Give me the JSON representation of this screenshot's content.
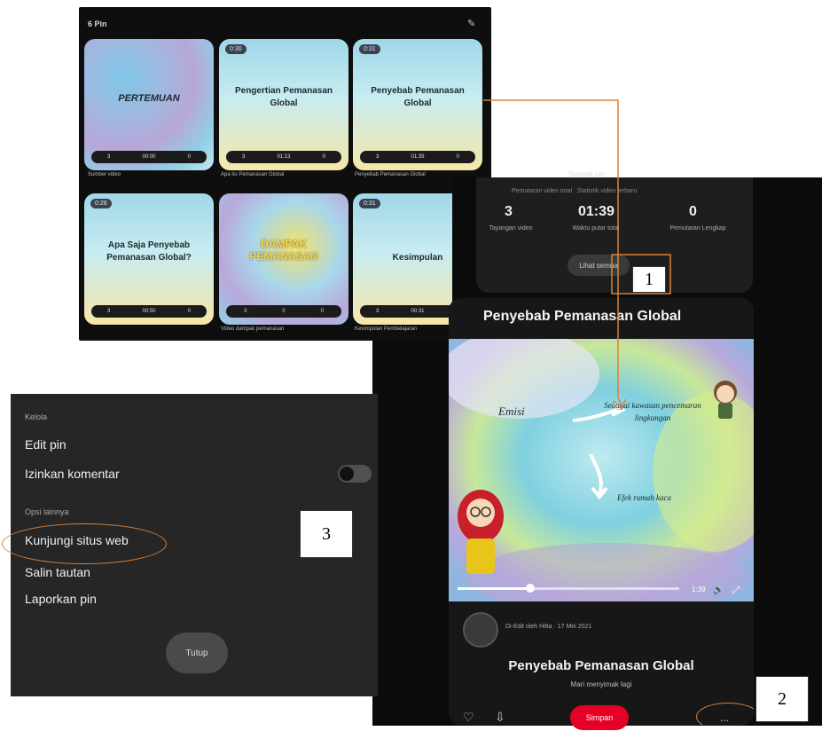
{
  "grid": {
    "title": "6 Pin",
    "cards": [
      {
        "badge": "",
        "text": "PERTEMUAN",
        "caption": "Sumber video",
        "stats": [
          "3",
          "00:00",
          "0"
        ]
      },
      {
        "badge": "0:30",
        "text": "Pengertian Pemanasan Global",
        "caption": "Apa itu Pemanasan Global",
        "stats": [
          "3",
          "01:13",
          "0"
        ]
      },
      {
        "badge": "0:31",
        "text": "Penyebab Pemanasan Global",
        "caption": "Penyebab Pemanasan Global",
        "stats": [
          "3",
          "01:39",
          "0"
        ]
      },
      {
        "badge": "0:28",
        "text": "Apa Saja Penyebab Pemanasan Global?",
        "caption": "",
        "stats": [
          "3",
          "00:50",
          "0"
        ]
      },
      {
        "badge": "",
        "text": "DAMPAK PEMANASAN",
        "caption": "Video dampak pemanasan",
        "stats": [
          "3",
          "0",
          "0"
        ]
      },
      {
        "badge": "0:31",
        "text": "Kesimpulan",
        "caption": "Kesimpulan Pembelajaran",
        "stats": [
          "3",
          "00:31",
          "0"
        ]
      }
    ]
  },
  "menu": {
    "section1": "Kelola",
    "edit_pin": "Edit pin",
    "allow_comments": "Izinkan komentar",
    "section2": "Opsi lainnya",
    "visit_site": "Kunjungi situs web",
    "copy_link": "Salin tautan",
    "report": "Laporkan pin",
    "close": "Tutup"
  },
  "labels": {
    "one": "1",
    "two": "2",
    "three": "3"
  },
  "stats": {
    "title": "Statistik pin",
    "subtitle": "Pemutaran video total   Statistik video terbaru",
    "values": [
      {
        "num": "3",
        "label": "Tayangan video"
      },
      {
        "num": "01:39",
        "label": "Waktu putar total"
      },
      {
        "num": "0",
        "label": "Pemutaran Lengkap"
      }
    ],
    "view_all": "Lihat semua"
  },
  "pin": {
    "title_top": "Penyebab Pemanasan Global",
    "video_label_1": "Emisi",
    "video_label_2": "Sebagai kawasan pencemaran lingkungan",
    "video_label_3": "Efek rumah kaca",
    "meta": "Di-Edit oleh Hitta · 17 Mei 2021",
    "title": "Penyebab Pemanasan Global",
    "description": "Mari menyimak lagi",
    "save": "Simpan",
    "more": "..."
  }
}
